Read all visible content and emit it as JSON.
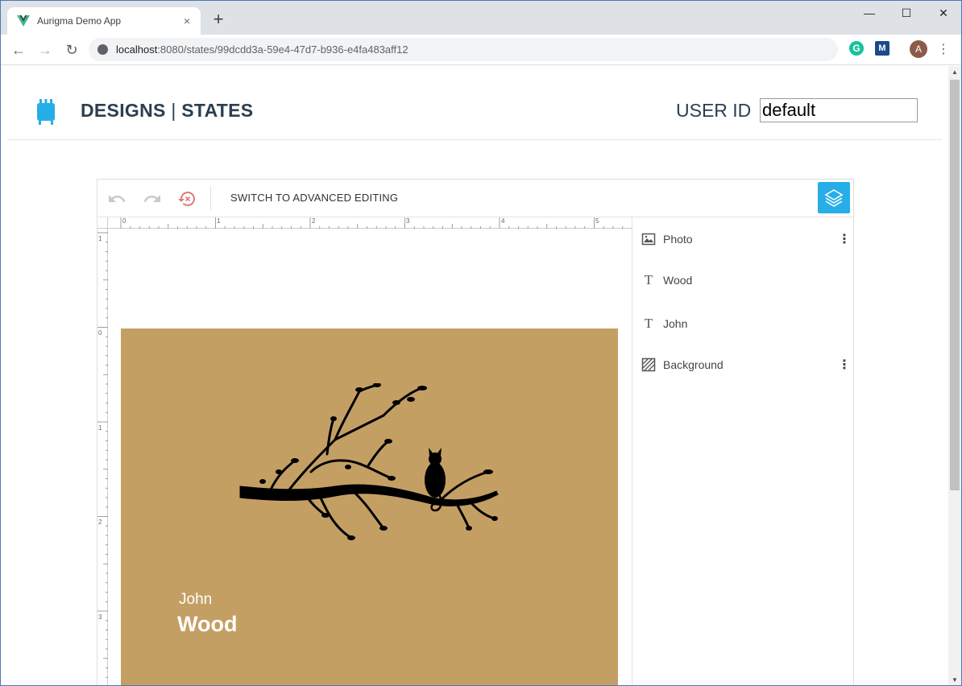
{
  "browser": {
    "tab_title": "Aurigma Demo App",
    "tab_close": "×",
    "new_tab": "+",
    "url_host": "localhost",
    "url_rest": ":8080/states/99dcdd3a-59e4-47d7-b936-e4fa483aff12",
    "window_controls": {
      "minimize": "—",
      "maximize": "☐",
      "close": "✕"
    },
    "nav": {
      "back": "←",
      "forward": "→",
      "reload": "↻"
    },
    "extensions": {
      "grammarly": "G",
      "m": "M"
    },
    "avatar_letter": "A",
    "menu": "⋮",
    "scroll_up": "▲",
    "scroll_down": "▼"
  },
  "header": {
    "designs_link": "DESIGNS",
    "separator": " | ",
    "states_link": "STATES",
    "user_id_label": "USER ID",
    "user_id_value": "default"
  },
  "editor": {
    "toolbar": {
      "undo": "undo-icon",
      "redo": "redo-icon",
      "reset": "history-reset-icon",
      "advanced_button": "SWITCH TO ADVANCED EDITING",
      "layers_toggle": "layers-icon"
    },
    "ruler": {
      "top_ticks": [
        "0",
        "1",
        "2",
        "3",
        "4",
        "5"
      ],
      "left_ticks": [
        "1",
        "0",
        "1",
        "2",
        "3"
      ]
    },
    "design": {
      "background_color": "#c49f64",
      "name": "John",
      "surname": "Wood"
    },
    "layers": [
      {
        "label": "Photo",
        "icon": "image-icon",
        "has_menu": true
      },
      {
        "label": "Wood",
        "icon": "text-icon",
        "has_menu": false
      },
      {
        "label": "John",
        "icon": "text-icon",
        "has_menu": false
      },
      {
        "label": "Background",
        "icon": "background-icon",
        "has_menu": true
      }
    ],
    "accent_color": "#27aee8"
  }
}
